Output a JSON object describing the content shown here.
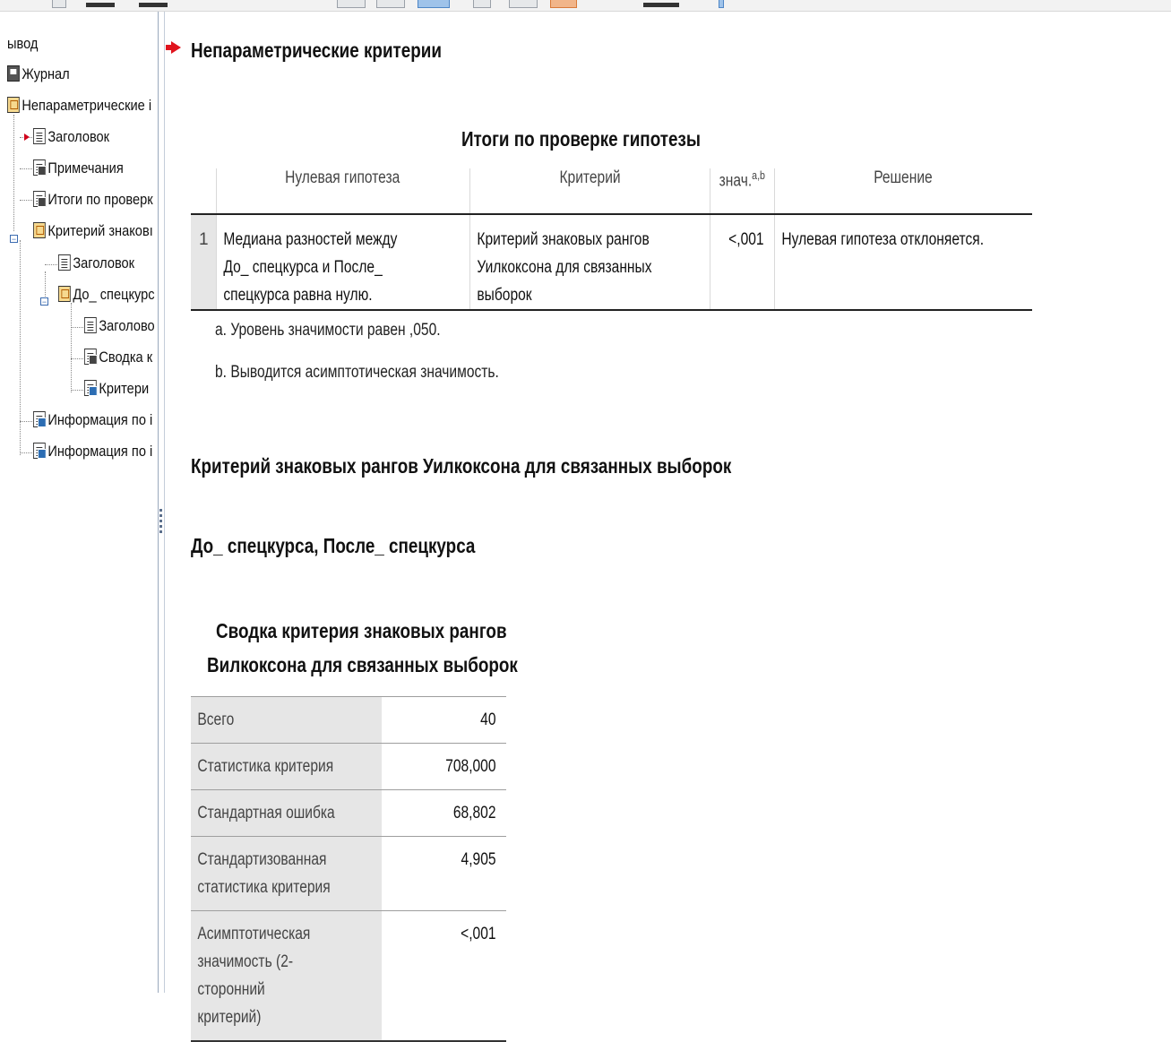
{
  "nav": {
    "items": [
      {
        "label": "ывод",
        "icon": "none"
      },
      {
        "label": "Журнал",
        "icon": "log-icon"
      },
      {
        "label": "Непараметрические i",
        "icon": "procedure-icon"
      },
      {
        "label": "Заголовок",
        "icon": "title-icon"
      },
      {
        "label": "Примечания",
        "icon": "notes-icon"
      },
      {
        "label": "Итоги по проверк",
        "icon": "table-icon"
      },
      {
        "label": "Критерий знаковı",
        "icon": "procedure-icon"
      },
      {
        "label": "Заголовок",
        "icon": "title-icon"
      },
      {
        "label": "До_ спецкурс",
        "icon": "procedure-icon"
      },
      {
        "label": "Заголово",
        "icon": "title-icon"
      },
      {
        "label": "Сводка к",
        "icon": "table-icon"
      },
      {
        "label": "Критери",
        "icon": "chart-icon"
      },
      {
        "label": "Информация по i",
        "icon": "chart-icon"
      },
      {
        "label": "Информация по i",
        "icon": "chart-icon"
      }
    ]
  },
  "main": {
    "heading": "Непараметрические критерии",
    "hypothesis_summary": {
      "title": "Итоги по проверке гипотезы",
      "columns": {
        "null": "Нулевая гипотеза",
        "test": "Критерий",
        "sig": "знач.",
        "sig_sup": "a,b",
        "decision": "Решение"
      },
      "row": {
        "num": "1",
        "hypothesis": "Медиана разностей между До_ спецкурса и После_ спецкурса равна нулю.",
        "test": "Критерий знаковых рангов Уилкоксона для связанных выборок",
        "sig": "<,001",
        "decision": "Нулевая гипотеза отклоняется."
      },
      "footnote_a": "a. Уровень значимости равен ,050.",
      "footnote_b": "b. Выводится асимптотическая значимость."
    },
    "wilcoxon_heading": "Критерий знаковых рангов Уилкоксона для связанных выборок",
    "pair_heading": "До_ спецкурса, После_ спецкурса",
    "summary": {
      "title_line1": "Сводка критерия знаковых рангов",
      "title_line2": "Вилкоксона для связанных выборок",
      "rows": [
        {
          "label": "Всего",
          "value": "40"
        },
        {
          "label": "Статистика критерия",
          "value": "708,000"
        },
        {
          "label": "Стандартная ошибка",
          "value": "68,802"
        },
        {
          "label": "Стандартизованная статистика критерия",
          "value": "4,905"
        },
        {
          "label": "Асимптотическая значимость (2-сторонний критерий)",
          "value": "<,001"
        }
      ]
    }
  },
  "colors": {
    "accent_arrow": "#e0141e",
    "header_shade": "#e6e6e6"
  }
}
